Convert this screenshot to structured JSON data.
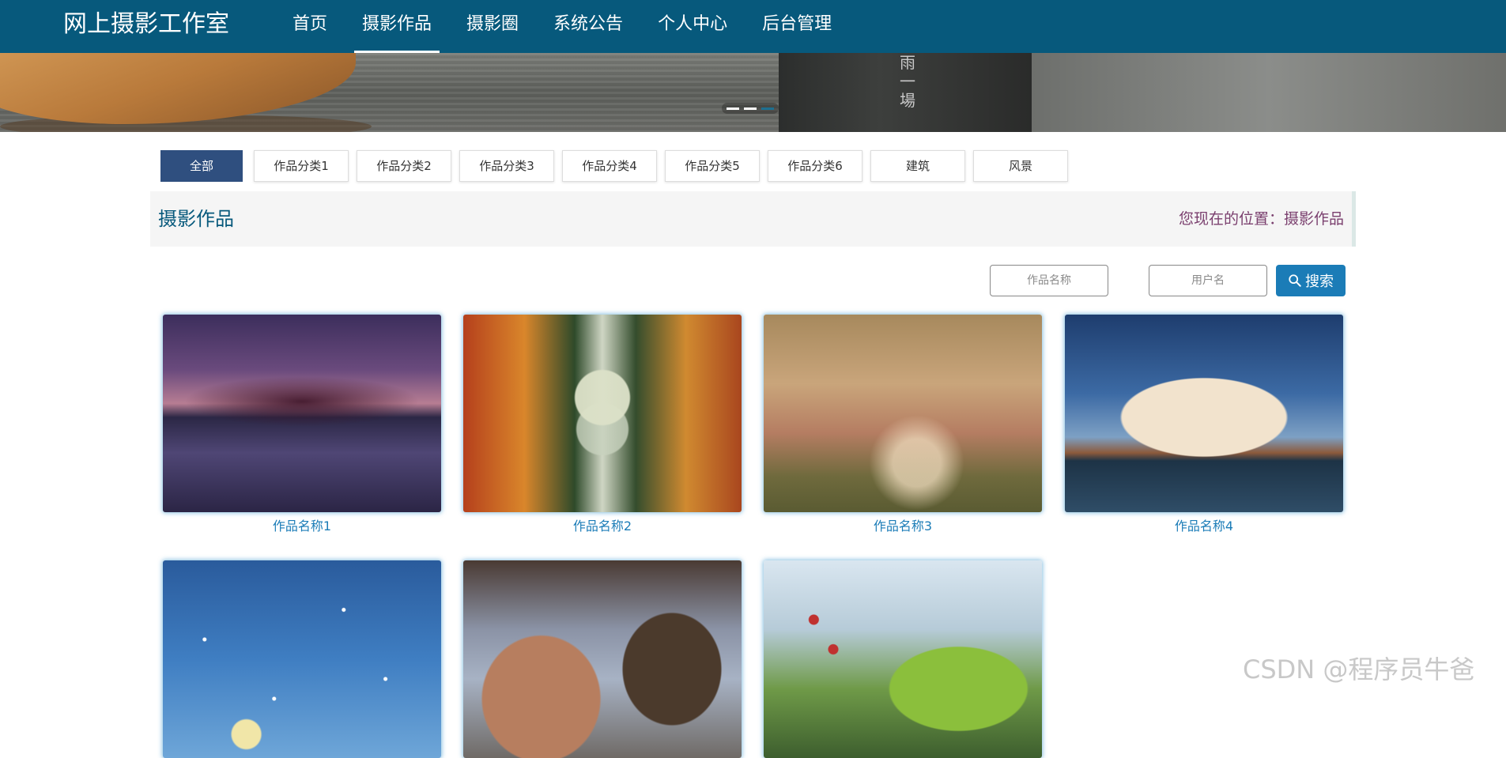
{
  "header": {
    "logo": "网上摄影工作室",
    "nav": [
      {
        "label": "首页",
        "active": false
      },
      {
        "label": "摄影作品",
        "active": true
      },
      {
        "label": "摄影圈",
        "active": false
      },
      {
        "label": "系统公告",
        "active": false
      },
      {
        "label": "个人中心",
        "active": false
      },
      {
        "label": "后台管理",
        "active": false
      }
    ]
  },
  "banner": {
    "sign_text": "雨一場",
    "slides": 3,
    "active_slide": 3
  },
  "categories": {
    "items": [
      "全部",
      "作品分类1",
      "作品分类2",
      "作品分类3",
      "作品分类4",
      "作品分类5",
      "作品分类6",
      "建筑",
      "风景"
    ],
    "active": "全部"
  },
  "section": {
    "title": "摄影作品",
    "breadcrumb": "您现在的位置：摄影作品"
  },
  "search": {
    "work_name_placeholder": "作品名称",
    "user_name_placeholder": "用户名",
    "button_label": "搜索"
  },
  "works": [
    {
      "name": "作品名称1"
    },
    {
      "name": "作品名称2"
    },
    {
      "name": "作品名称3"
    },
    {
      "name": "作品名称4"
    },
    {
      "name": ""
    },
    {
      "name": ""
    },
    {
      "name": ""
    }
  ],
  "watermark": "CSDN @程序员牛爸",
  "colors": {
    "header_bg": "#07597c",
    "active_category": "#2f4f7f",
    "search_button": "#1b7cb7",
    "caption": "#1b7cb7",
    "breadcrumb": "#7a3f6e"
  }
}
